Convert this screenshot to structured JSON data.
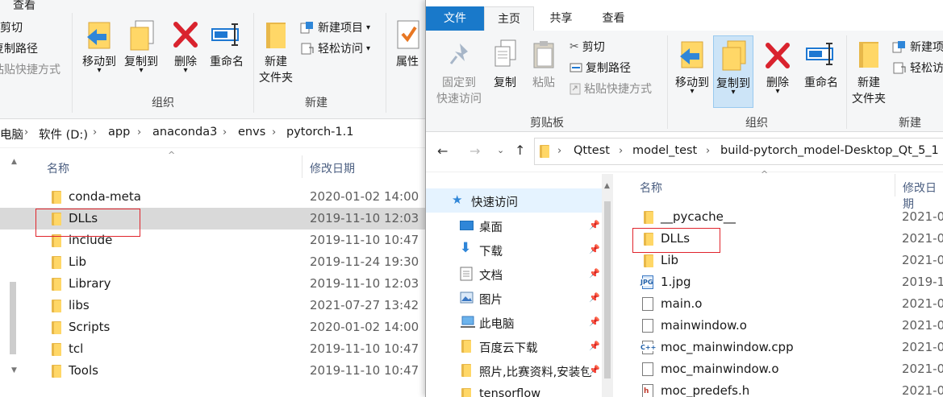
{
  "left": {
    "ribbon_tab": "查看",
    "clipboard": {
      "cut": "剪切",
      "copy_path": "复制路径",
      "paste_shortcut": "粘贴快捷方式"
    },
    "organize": {
      "move_to": "移动到",
      "copy_to": "复制到",
      "delete": "删除",
      "rename": "重命名",
      "label": "组织"
    },
    "new": {
      "new_folder_line1": "新建",
      "new_folder_line2": "文件夹",
      "new_item": "新建项目",
      "easy_access": "轻松访问",
      "label": "新建"
    },
    "open": {
      "properties": "属性"
    },
    "breadcrumb": [
      "电脑",
      "软件 (D:)",
      "app",
      "anaconda3",
      "envs",
      "pytorch-1.1"
    ],
    "columns": {
      "name": "名称",
      "date": "修改日期"
    },
    "files": [
      {
        "name": "conda-meta",
        "date": "2020-01-02 14:00"
      },
      {
        "name": "DLLs",
        "date": "2019-11-10 12:03"
      },
      {
        "name": "include",
        "date": "2019-11-10 10:47"
      },
      {
        "name": "Lib",
        "date": "2019-11-24 19:30"
      },
      {
        "name": "Library",
        "date": "2019-11-10 12:03"
      },
      {
        "name": "libs",
        "date": "2021-07-27 13:42"
      },
      {
        "name": "Scripts",
        "date": "2020-01-02 14:00"
      },
      {
        "name": "tcl",
        "date": "2019-11-10 10:47"
      },
      {
        "name": "Tools",
        "date": "2019-11-10 10:47"
      }
    ]
  },
  "right": {
    "tabs": {
      "file": "文件",
      "home": "主页",
      "share": "共享",
      "view": "查看"
    },
    "clipboard": {
      "pin_line1": "固定到",
      "pin_line2": "快速访问",
      "copy": "复制",
      "paste": "粘贴",
      "cut": "剪切",
      "copy_path": "复制路径",
      "paste_shortcut": "粘贴快捷方式",
      "label": "剪贴板"
    },
    "organize": {
      "move_to": "移动到",
      "copy_to": "复制到",
      "delete": "删除",
      "rename": "重命名",
      "label": "组织"
    },
    "new": {
      "new_folder_line1": "新建",
      "new_folder_line2": "文件夹",
      "new_item": "新建项",
      "easy_access": "轻松访",
      "label": "新建"
    },
    "breadcrumb": [
      "Qttest",
      "model_test",
      "build-pytorch_model-Desktop_Qt_5_1"
    ],
    "nav": [
      {
        "label": "快速访问"
      },
      {
        "label": "桌面"
      },
      {
        "label": "下载"
      },
      {
        "label": "文档"
      },
      {
        "label": "图片"
      },
      {
        "label": "此电脑"
      },
      {
        "label": "百度云下载"
      },
      {
        "label": "照片,比赛资料,安装包"
      },
      {
        "label": "tensorflow"
      }
    ],
    "columns": {
      "name": "名称",
      "date": "修改日期"
    },
    "files": [
      {
        "name": "__pycache__",
        "date": "2021-0"
      },
      {
        "name": "DLLs",
        "date": "2021-0"
      },
      {
        "name": "Lib",
        "date": "2021-0"
      },
      {
        "name": "1.jpg",
        "date": "2019-1"
      },
      {
        "name": "main.o",
        "date": "2021-0"
      },
      {
        "name": "mainwindow.o",
        "date": "2021-0"
      },
      {
        "name": "moc_mainwindow.cpp",
        "date": "2021-0"
      },
      {
        "name": "moc_mainwindow.o",
        "date": "2021-0"
      },
      {
        "name": "moc_predefs.h",
        "date": "2021-0"
      }
    ]
  }
}
